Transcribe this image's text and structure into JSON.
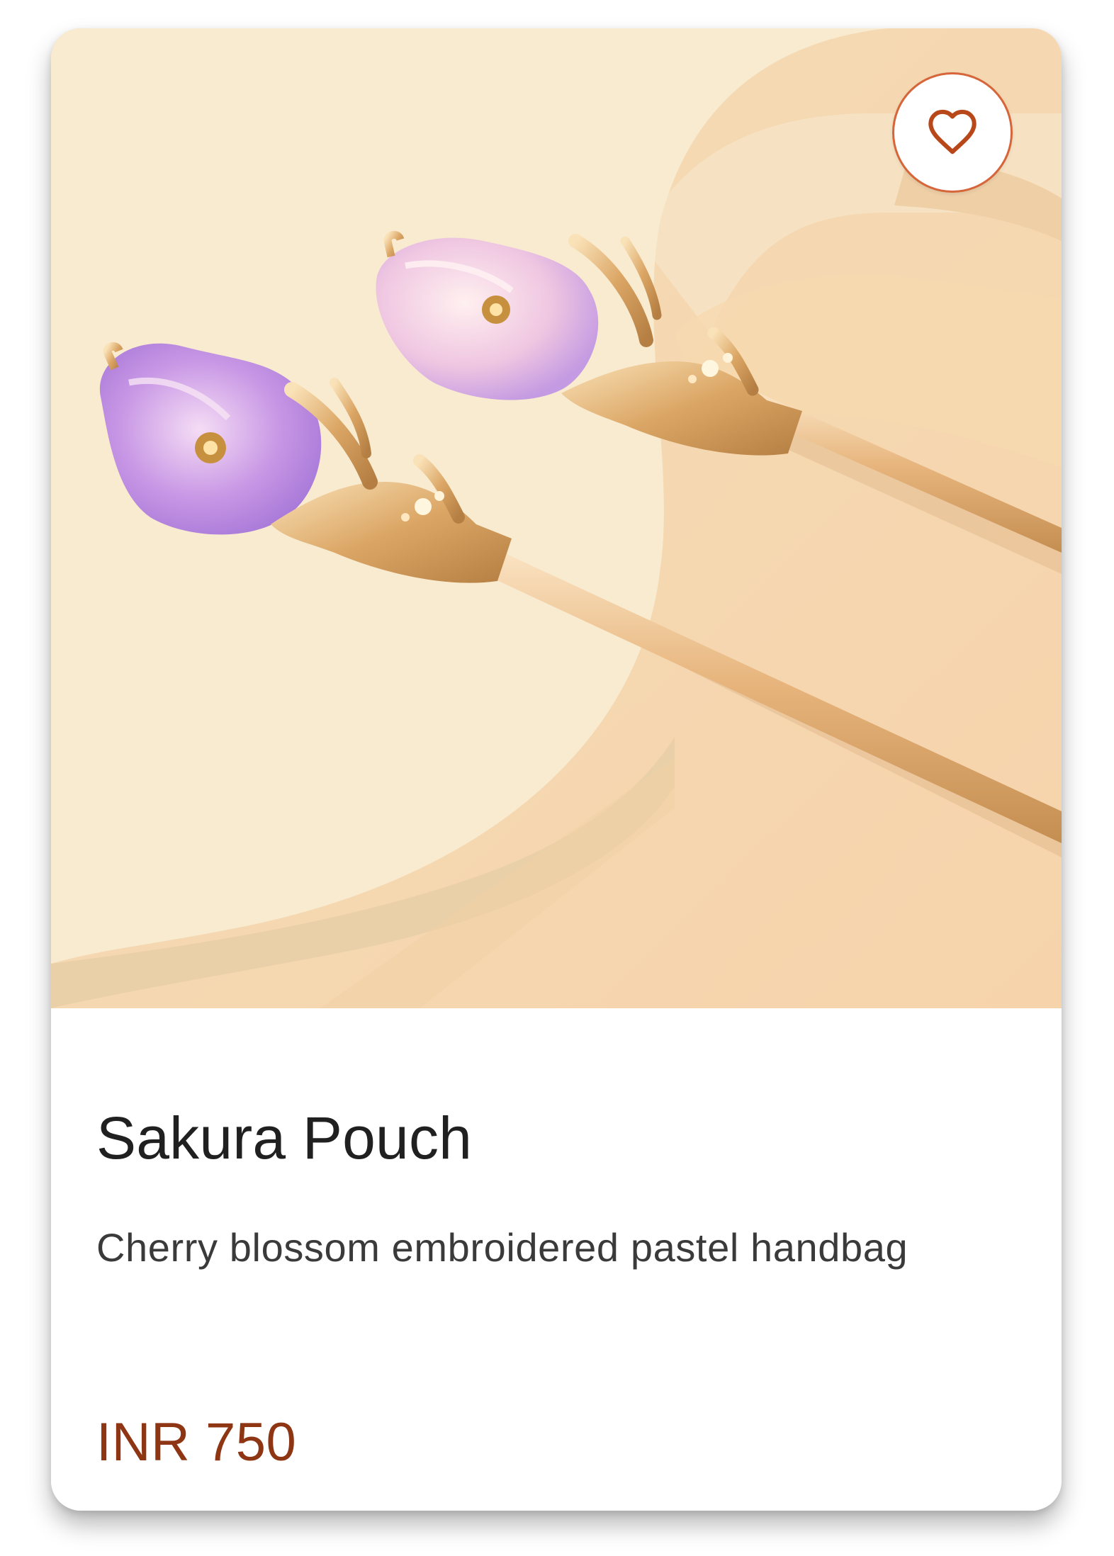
{
  "product": {
    "title": "Sakura Pouch",
    "description": "Cherry blossom embroidered pastel handbag",
    "price": "INR 750"
  },
  "favorite": {
    "icon": "heart-outline-icon",
    "accent_color": "#d6653a"
  },
  "colors": {
    "price": "#8e3514",
    "title": "#202020",
    "description": "#3a3a3a"
  }
}
